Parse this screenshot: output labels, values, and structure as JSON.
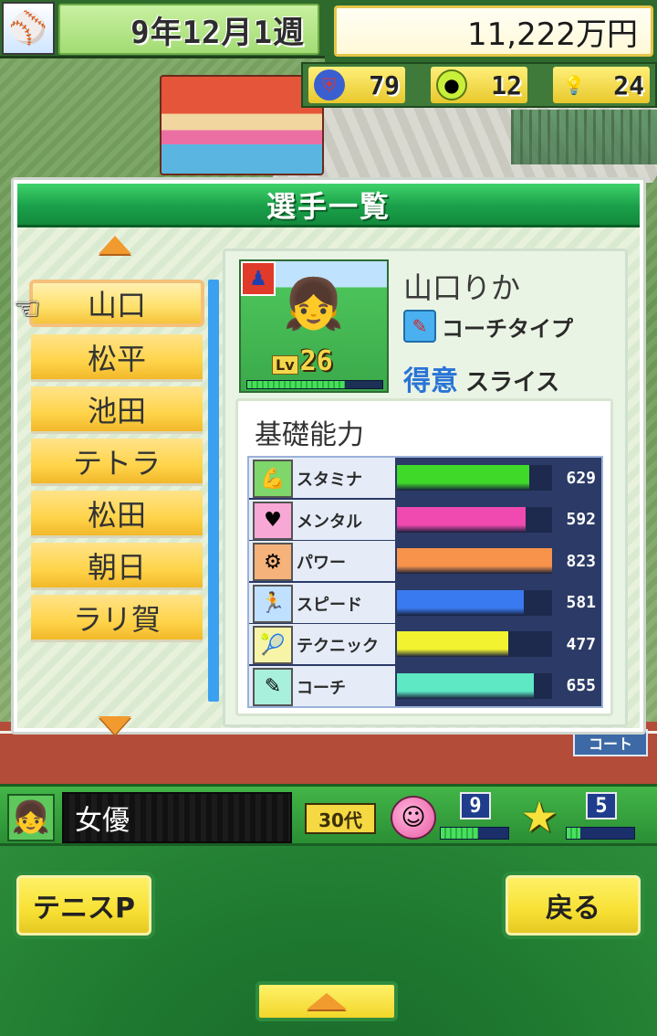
{
  "hud": {
    "date": "9年12月1週",
    "money": "11,222万円",
    "stats": [
      {
        "icon": "shield-icon",
        "value": "79",
        "color": "#d23a3a"
      },
      {
        "icon": "tennis-ball-icon",
        "value": "12",
        "color": "#a6d62a"
      },
      {
        "icon": "lightbulb-icon",
        "value": "24",
        "color": "#f7d84a"
      }
    ]
  },
  "modal": {
    "title": "選手一覧",
    "players": [
      "山口",
      "松平",
      "池田",
      "テトラ",
      "松田",
      "朝日",
      "ラリ賀"
    ],
    "selected_index": 0
  },
  "detail": {
    "name": "山口りか",
    "type_label": "コーチタイプ",
    "strength_key": "得意",
    "strength_value": "スライス",
    "level_label": "Lv",
    "level": "26",
    "exp_fraction": 0.72,
    "abilities_title": "基礎能力",
    "abilities": [
      {
        "name": "スタミナ",
        "value": "629",
        "fraction": 0.85,
        "color": "#3fd92a",
        "icon": "arm-icon",
        "icon_bg": "#7fd66a"
      },
      {
        "name": "メンタル",
        "value": "592",
        "fraction": 0.83,
        "color": "#f04ab0",
        "icon": "heart-icon",
        "icon_bg": "#f7a8d4"
      },
      {
        "name": "パワー",
        "value": "823",
        "fraction": 1.0,
        "color": "#f7934a",
        "icon": "dumbbell-icon",
        "icon_bg": "#f5b27a"
      },
      {
        "name": "スピード",
        "value": "581",
        "fraction": 0.82,
        "color": "#3a7af0",
        "icon": "runner-icon",
        "icon_bg": "#bfe0ff"
      },
      {
        "name": "テクニック",
        "value": "477",
        "fraction": 0.72,
        "color": "#f2f230",
        "icon": "racket-icon",
        "icon_bg": "#f7f4a8"
      },
      {
        "name": "コーチ",
        "value": "655",
        "fraction": 0.88,
        "color": "#5fe8c4",
        "icon": "whistle-icon",
        "icon_bg": "#a8f0dc"
      }
    ]
  },
  "court_badge": "コート",
  "status": {
    "job": "女優",
    "age": "30代",
    "mood_value": "9",
    "mood_fraction": 0.55,
    "star_value": "5",
    "star_fraction": 0.2
  },
  "controls": {
    "tennis_label": "テニスP",
    "back_label": "戻る"
  }
}
